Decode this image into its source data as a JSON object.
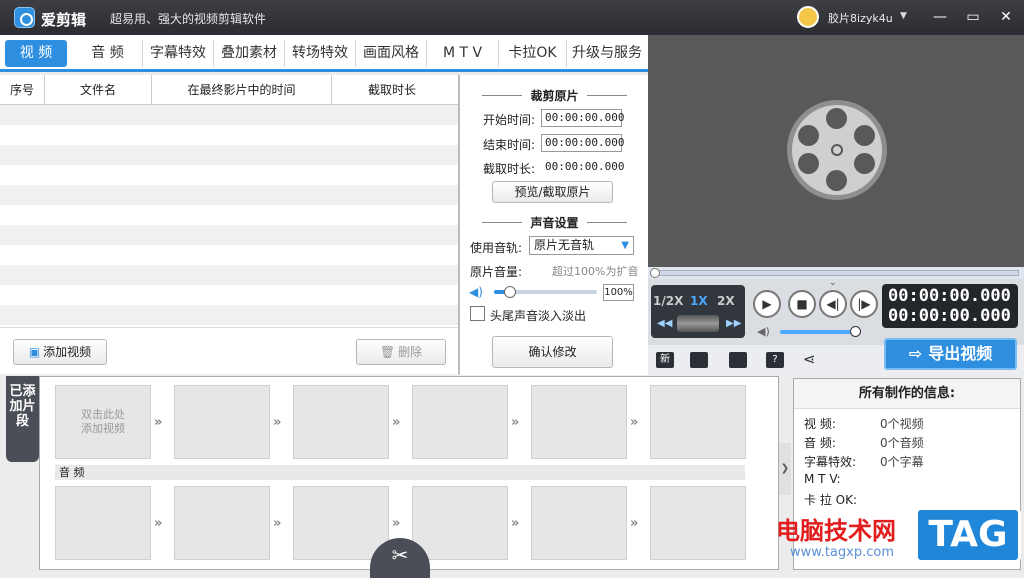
{
  "titlebar": {
    "app_name": "爱剪辑",
    "slogan": "超易用、强大的视频剪辑软件",
    "username": "胶片8izyk4u",
    "chevron": "▼",
    "window_buttons": {
      "minimize": "—",
      "maximize": "▭",
      "close": "✕"
    }
  },
  "tabs": [
    {
      "label": "视 频",
      "active": true
    },
    {
      "label": "音 频"
    },
    {
      "label": "字幕特效"
    },
    {
      "label": "叠加素材"
    },
    {
      "label": "转场特效"
    },
    {
      "label": "画面风格"
    },
    {
      "label": "M T V"
    },
    {
      "label": "卡拉OK"
    },
    {
      "label": "升级与服务"
    }
  ],
  "clip_table": {
    "columns": [
      "序号",
      "文件名",
      "在最终影片中的时间",
      "截取时长"
    ],
    "add_button": "添加视频",
    "delete_button": "删除"
  },
  "crop": {
    "section_title": "裁剪原片",
    "start_label": "开始时间:",
    "start_value": "00:00:00.000",
    "end_label": "结束时间:",
    "end_value": "00:00:00.000",
    "duration_label": "截取时长:",
    "duration_value": "00:00:00.000",
    "preview_button": "预览/截取原片"
  },
  "audio_settings": {
    "section_title": "声音设置",
    "track_label": "使用音轨:",
    "track_value": "原片无音轨",
    "volume_label": "原片音量:",
    "volume_hint": "超过100%为扩音",
    "volume_value": "100%",
    "fade_label": "头尾声音淡入淡出",
    "confirm_button": "确认修改"
  },
  "player": {
    "speeds": [
      "1/2X",
      "1X",
      "2X"
    ],
    "active_speed": "1X",
    "timecode_current": "00:00:00.000",
    "timecode_total": "00:00:00.000",
    "playback_progress": 0,
    "export_button": "导出视频"
  },
  "toolbar_icons": [
    "new-icon",
    "folder-icon",
    "save-icon",
    "help-icon",
    "share-icon"
  ],
  "timeline": {
    "side_tab": "已添加片段",
    "placeholder_line1": "双击此处",
    "placeholder_line2": "添加视频",
    "audio_label": "音 频"
  },
  "info": {
    "title": "所有制作的信息:",
    "rows": [
      {
        "key": "视    频:",
        "value": "0个视频"
      },
      {
        "key": "音    频:",
        "value": "0个音频"
      },
      {
        "key": "字幕特效:",
        "value": "0个字幕"
      },
      {
        "key": "M  T  V:",
        "value": ""
      },
      {
        "key": "卡 拉 OK:",
        "value": ""
      }
    ]
  },
  "watermark": {
    "text": "电脑技术网",
    "url": "www.tagxp.com",
    "logo": "TAG"
  },
  "colors": {
    "accent": "#2e8fe0",
    "titlebar": "#2b2c31",
    "watermark": "#e11d1d"
  }
}
